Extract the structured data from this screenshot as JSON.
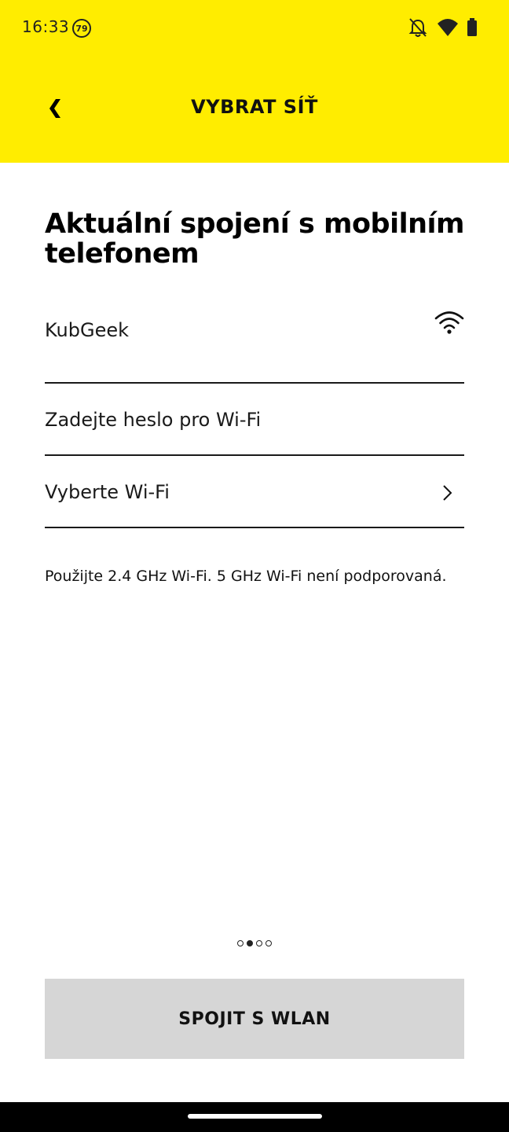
{
  "status_bar": {
    "time": "16:33",
    "badge": "79",
    "icons": [
      "bell-off-icon",
      "wifi-icon",
      "battery-icon"
    ]
  },
  "appbar": {
    "title": "VYBRAT SÍŤ",
    "back_icon": "chevron-left-icon"
  },
  "main": {
    "heading": "Aktuální spojení s mobilním telefonem",
    "current_network": "KubGeek",
    "password_placeholder": "Zadejte heslo pro Wi-Fi",
    "select_label": "Vyberte Wi-Fi",
    "note": "Použijte 2.4 GHz Wi-Fi. 5 GHz Wi-Fi není podporovaná."
  },
  "pager": {
    "count": 4,
    "active_index": 1
  },
  "actions": {
    "connect_label": "SPOJIT S WLAN"
  },
  "colors": {
    "header": "#FFED00",
    "button": "#D6D6D6",
    "text": "#111111"
  }
}
